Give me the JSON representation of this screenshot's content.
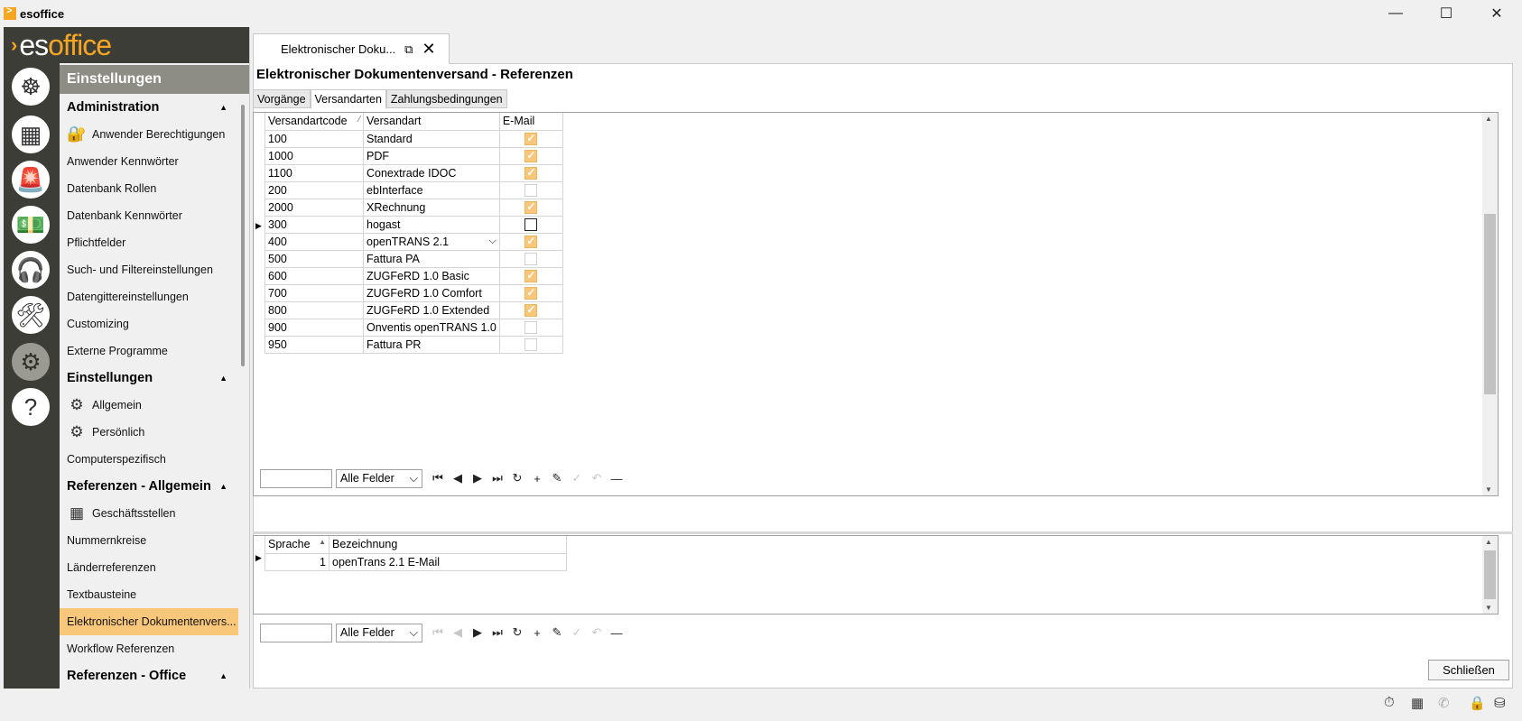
{
  "app": {
    "title": "esoffice",
    "brand_es": "es",
    "brand_office": "office"
  },
  "window_controls": {
    "minimize": "—",
    "maximize": "☐",
    "close": "✕"
  },
  "nav_icons": [
    {
      "name": "helm-icon",
      "glyph": "☸"
    },
    {
      "name": "dashboard-icon",
      "glyph": "▦"
    },
    {
      "name": "alarm-icon",
      "glyph": "🚨"
    },
    {
      "name": "money-icon",
      "glyph": "💵"
    },
    {
      "name": "headset-icon",
      "glyph": "🎧"
    },
    {
      "name": "tools-icon",
      "glyph": "🛠"
    },
    {
      "name": "gears-icon",
      "glyph": "⚙"
    },
    {
      "name": "help-icon",
      "glyph": "?"
    }
  ],
  "settings": {
    "title": "Einstellungen",
    "sections": [
      {
        "title": "Administration",
        "items": [
          "Anwender Berechtigungen",
          "Anwender Kennwörter",
          "Datenbank Rollen",
          "Datenbank Kennwörter",
          "Pflichtfelder",
          "Such- und Filtereinstellungen",
          "Datengittereinstellungen",
          "Customizing",
          "Externe Programme"
        ]
      },
      {
        "title": "Einstellungen",
        "items": [
          "Allgemein",
          "Persönlich",
          "Computerspezifisch"
        ]
      },
      {
        "title": "Referenzen - Allgemein",
        "items": [
          "Geschäftsstellen",
          "Nummernkreise",
          "Länderreferenzen",
          "Textbausteine",
          "Elektronischer Dokumentenvers...",
          "Workflow Referenzen"
        ]
      },
      {
        "title": "Referenzen - Office",
        "items": []
      }
    ]
  },
  "tab": {
    "label": "Elektronischer Doku..."
  },
  "page": {
    "title": "Elektronischer Dokumentenversand - Referenzen"
  },
  "subtabs": [
    "Vorgänge",
    "Versandarten",
    "Zahlungsbedingungen"
  ],
  "grid1": {
    "headers": [
      "Versandartcode",
      "Versandart",
      "E-Mail"
    ],
    "sort_indicator": "⁄",
    "rows": [
      {
        "code": "100",
        "name": "Standard",
        "email": true
      },
      {
        "code": "1000",
        "name": "PDF",
        "email": true
      },
      {
        "code": "1100",
        "name": "Conextrade IDOC",
        "email": true
      },
      {
        "code": "200",
        "name": "ebInterface",
        "email": false
      },
      {
        "code": "2000",
        "name": "XRechnung",
        "email": true
      },
      {
        "code": "300",
        "name": "hogast",
        "email": false
      },
      {
        "code": "400",
        "name": "openTRANS 2.1",
        "email": true
      },
      {
        "code": "500",
        "name": "Fattura PA",
        "email": false
      },
      {
        "code": "600",
        "name": "ZUGFeRD 1.0 Basic",
        "email": true
      },
      {
        "code": "700",
        "name": "ZUGFeRD 1.0 Comfort",
        "email": true
      },
      {
        "code": "800",
        "name": "ZUGFeRD 1.0 Extended",
        "email": true
      },
      {
        "code": "900",
        "name": "Onventis openTRANS 1.0",
        "email": false
      },
      {
        "code": "950",
        "name": "Fattura PR",
        "email": false
      }
    ]
  },
  "navigator": {
    "filter_label": "Alle Felder"
  },
  "grid2": {
    "headers": [
      "Sprache",
      "Bezeichnung"
    ],
    "rows": [
      {
        "lang": "1",
        "desc": "openTrans 2.1 E-Mail"
      }
    ]
  },
  "buttons": {
    "close": "Schließen"
  },
  "colors": {
    "accent": "#f5a623",
    "sidebar_dark": "#3d3d37",
    "selected": "#f8c77a"
  }
}
